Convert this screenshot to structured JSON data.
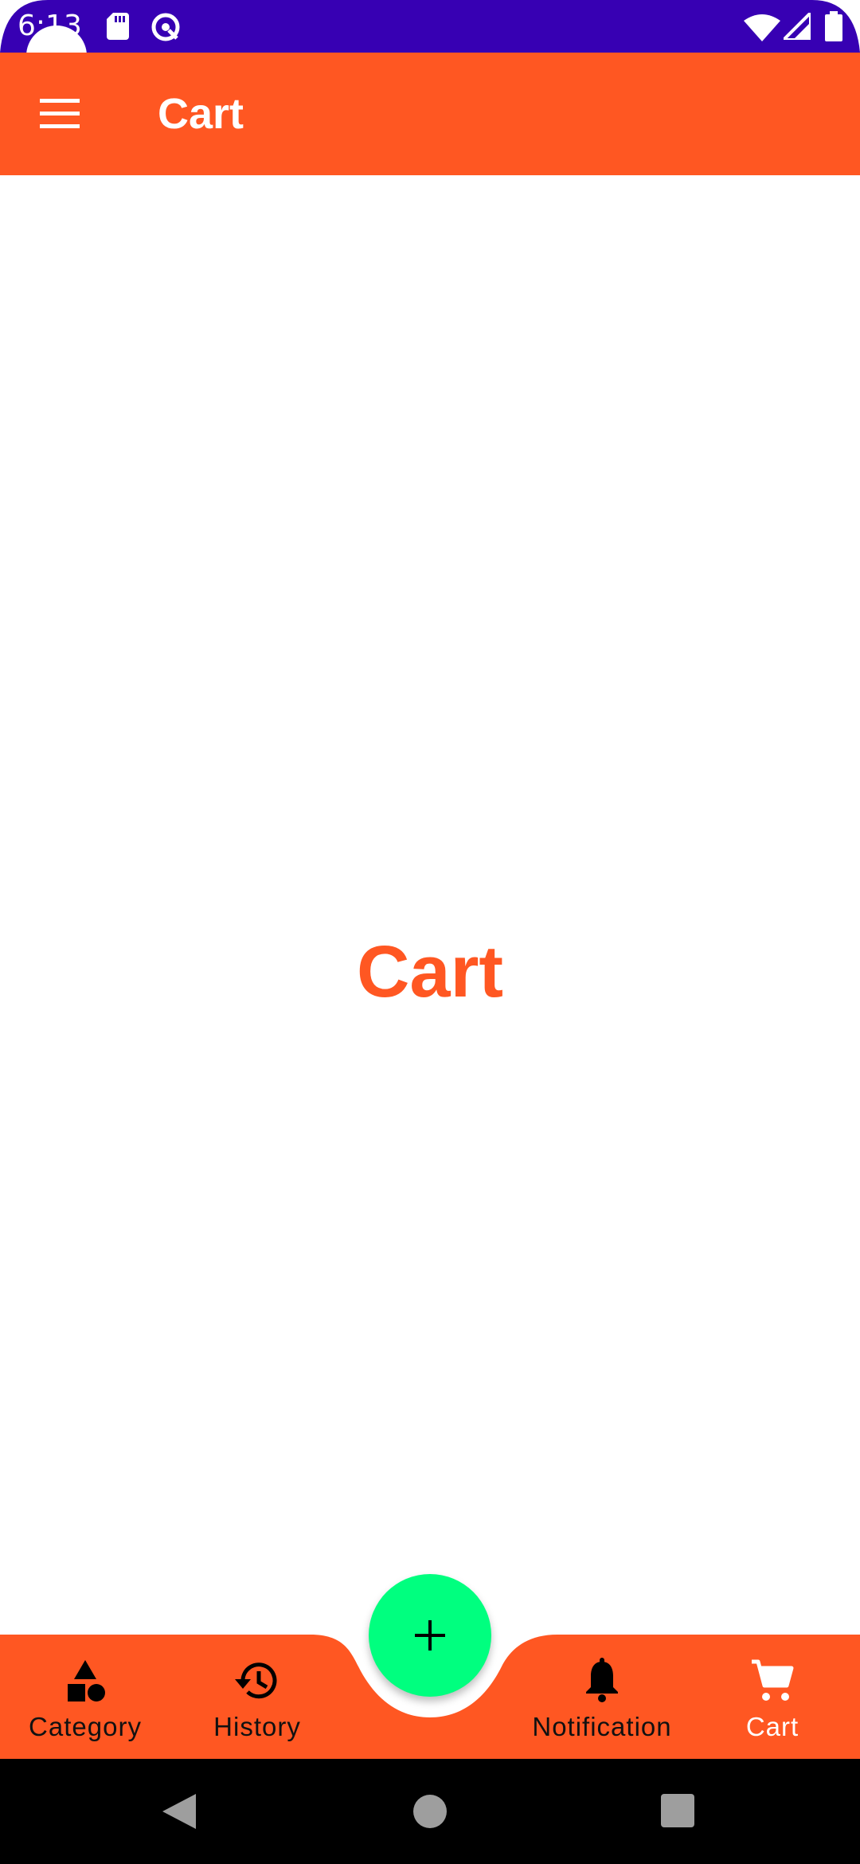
{
  "status_bar": {
    "time": "6:13",
    "icons": [
      "sd-card-icon",
      "data-saver-icon",
      "wifi-icon",
      "signal-icon",
      "battery-icon"
    ]
  },
  "app_bar": {
    "title": "Cart",
    "menu_icon": "hamburger-menu-icon"
  },
  "content": {
    "heading": "Cart"
  },
  "bottom_nav": {
    "items": [
      {
        "label": "Category",
        "icon": "category-shapes-icon",
        "active": false
      },
      {
        "label": "History",
        "icon": "history-icon",
        "active": false
      },
      {
        "label": "Notification",
        "icon": "bell-icon",
        "active": false
      },
      {
        "label": "Cart",
        "icon": "shopping-cart-icon",
        "active": true
      }
    ],
    "fab_icon": "plus-icon"
  },
  "system_nav": {
    "icons": [
      "back-icon",
      "home-icon",
      "recents-icon"
    ]
  },
  "colors": {
    "status_bar": "#3700B3",
    "primary": "#FF5722",
    "fab": "#00FF7F",
    "background": "#FFFFFF"
  }
}
